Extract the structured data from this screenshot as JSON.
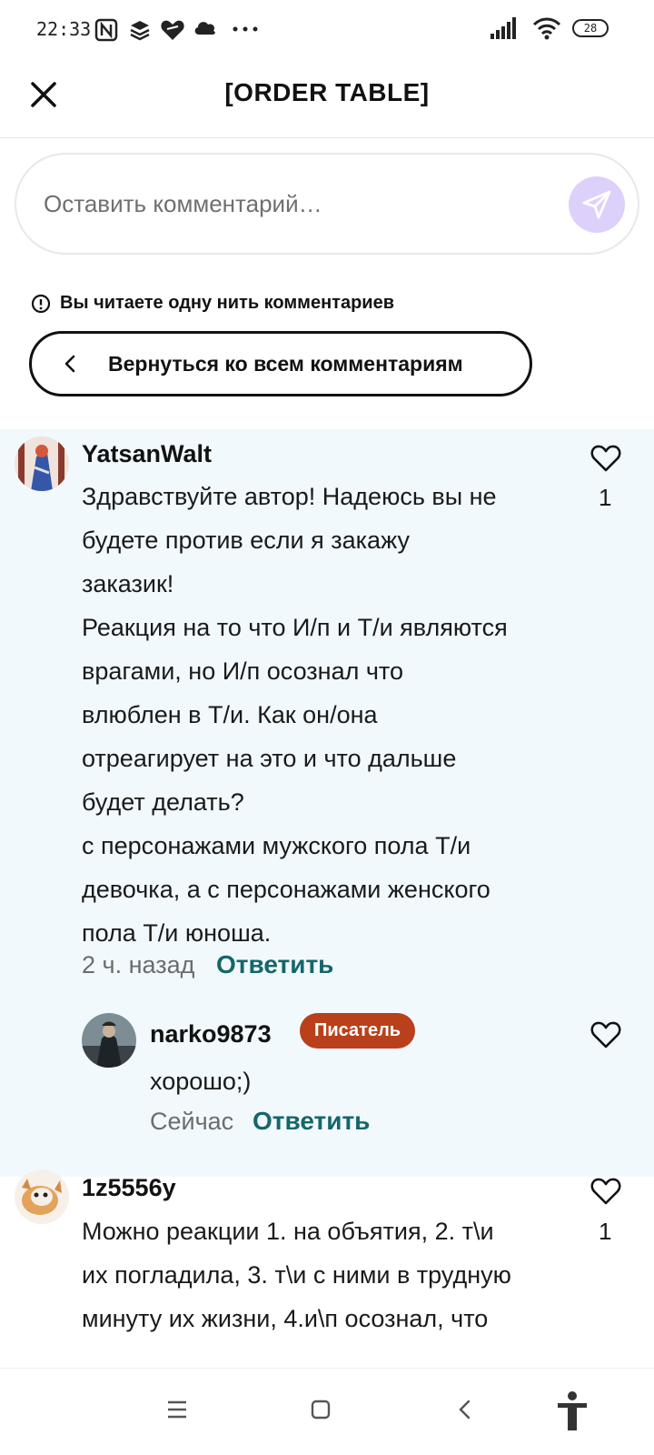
{
  "status_bar": {
    "time": "22:33",
    "battery": "28"
  },
  "header": {
    "title": "[ORDER TABLE]"
  },
  "comment_input": {
    "placeholder": "Оставить комментарий…"
  },
  "thread_notice": {
    "text": "Вы читаете одну нить комментариев",
    "back_label": "Вернуться ко всем комментариям"
  },
  "comments": [
    {
      "username": "YatsanWalt",
      "text": "Здравствуйте автор! Надеюсь вы не\nбудете против если я закажу\nзаказик!\nРеакция на то что И/п и Т/и являются\nврагами, но И/п осознал что\nвлюблен в Т/и. Как он/она\nотреагирует на это и что дальше\nбудет делать?\nс персонажами мужского пола Т/и\nдевочка, а с персонажами женского\nпола Т/и юноша.",
      "time": "2 ч. назад",
      "reply_label": "Ответить",
      "likes": "1"
    },
    {
      "username": "narko9873",
      "badge": "Писатель",
      "text": "хорошо;)",
      "time": "Сейчас",
      "reply_label": "Ответить",
      "likes": ""
    },
    {
      "username": "1z5556y",
      "text": "Можно реакции 1. на объятия, 2. т\\и\nих погладила, 3. т\\и с ними в трудную\nминуту их жизни, 4.и\\п осознал, что",
      "likes": "1"
    }
  ],
  "colors": {
    "accent": "#15666b",
    "thread_bg": "#f1f9fd",
    "badge_bg": "#b9401a",
    "send_bg": "#ddd1fb"
  }
}
